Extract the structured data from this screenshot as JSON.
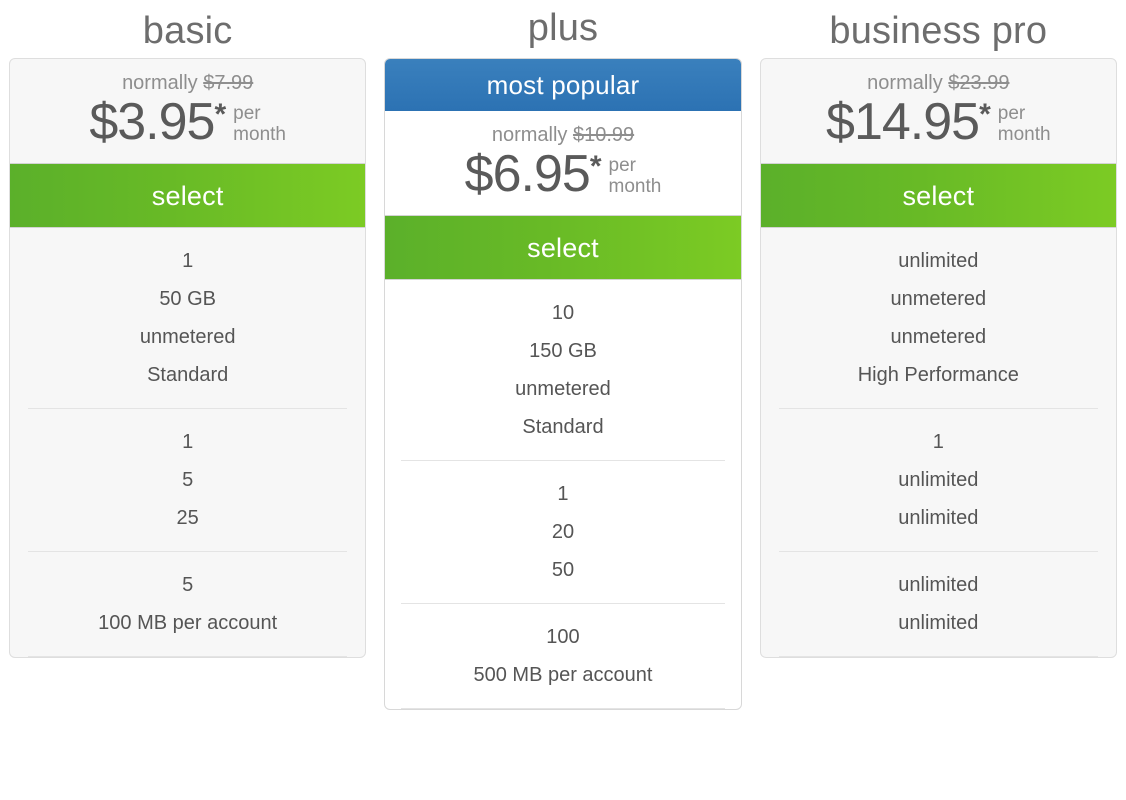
{
  "theme": {
    "accent_green": "#68ba26",
    "banner_blue": "#2f77b8",
    "text_gray": "#5a5a5a",
    "muted_gray": "#8e8e8e",
    "card_bg": "#f7f7f7",
    "featured_card_bg": "#ffffff"
  },
  "plans": [
    {
      "name": "basic",
      "featured": false,
      "badge": "",
      "normally_label": "normally",
      "old_price": "$7.99",
      "price": "$3.95",
      "asterisk": "*",
      "per": "per",
      "month": "month",
      "select_label": "select",
      "groups": [
        {
          "rows": [
            "1",
            "50 GB",
            "unmetered",
            "Standard"
          ]
        },
        {
          "rows": [
            "1",
            "5",
            "25"
          ]
        },
        {
          "rows": [
            "5",
            "100 MB per account"
          ]
        }
      ]
    },
    {
      "name": "plus",
      "featured": true,
      "badge": "most popular",
      "normally_label": "normally",
      "old_price": "$10.99",
      "price": "$6.95",
      "asterisk": "*",
      "per": "per",
      "month": "month",
      "select_label": "select",
      "groups": [
        {
          "rows": [
            "10",
            "150 GB",
            "unmetered",
            "Standard"
          ]
        },
        {
          "rows": [
            "1",
            "20",
            "50"
          ]
        },
        {
          "rows": [
            "100",
            "500 MB per account"
          ]
        }
      ]
    },
    {
      "name": "business pro",
      "featured": false,
      "badge": "",
      "normally_label": "normally",
      "old_price": "$23.99",
      "price": "$14.95",
      "asterisk": "*",
      "per": "per",
      "month": "month",
      "select_label": "select",
      "groups": [
        {
          "rows": [
            "unlimited",
            "unmetered",
            "unmetered",
            "High Performance"
          ]
        },
        {
          "rows": [
            "1",
            "unlimited",
            "unlimited"
          ]
        },
        {
          "rows": [
            "unlimited",
            "unlimited"
          ]
        }
      ]
    }
  ]
}
